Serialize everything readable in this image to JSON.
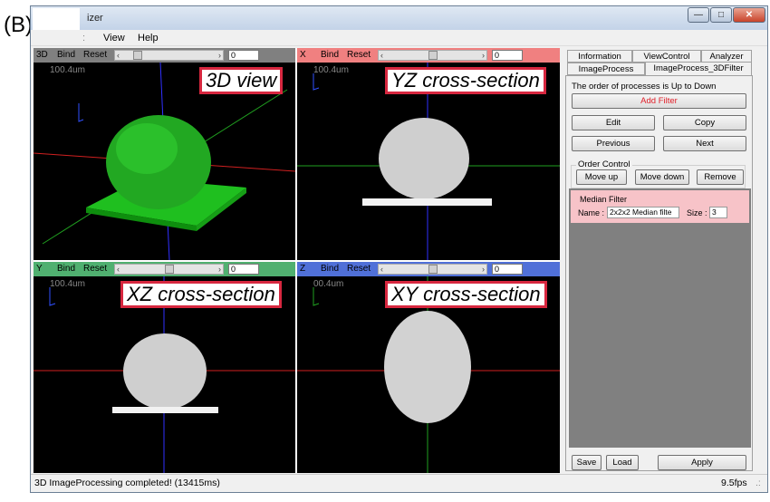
{
  "figure_label": "(B)",
  "window": {
    "title": "izer",
    "min_label": "—",
    "max_label": "□",
    "close_label": "✕"
  },
  "menu": {
    "view": "View",
    "help": "Help"
  },
  "viewports": {
    "v3d": {
      "label": "3D",
      "bind": "Bind",
      "reset": "Reset",
      "value": "0",
      "scale": "100.4um",
      "caption": "3D view",
      "bar_color": "#808080"
    },
    "vx": {
      "label": "X",
      "bind": "Bind",
      "reset": "Reset",
      "value": "0",
      "scale": "100.4um",
      "caption": "YZ cross-section",
      "bar_color": "#f08080"
    },
    "vy": {
      "label": "Y",
      "bind": "Bind",
      "reset": "Reset",
      "value": "0",
      "scale": "100.4um",
      "caption": "XZ cross-section",
      "bar_color": "#50b070"
    },
    "vz": {
      "label": "Z",
      "bind": "Bind",
      "reset": "Reset",
      "value": "0",
      "scale": "00.4um",
      "caption": "XY cross-section",
      "bar_color": "#5070d8"
    }
  },
  "tabs": {
    "information": "Information",
    "viewcontrol": "ViewControl",
    "analyzer": "Analyzer",
    "imageprocess": "ImageProcess",
    "imageprocess3d": "ImageProcess_3DFilter"
  },
  "panel": {
    "order_note": "The order of processes is Up to Down",
    "add_filter": "Add Filter",
    "edit": "Edit",
    "copy": "Copy",
    "previous": "Previous",
    "next": "Next",
    "order_control": "Order Control",
    "move_up": "Move up",
    "move_down": "Move down",
    "remove": "Remove",
    "save": "Save",
    "load": "Load",
    "apply": "Apply"
  },
  "filter": {
    "title": "Median Filter",
    "name_label": "Name :",
    "name_value": "2x2x2 Median filte",
    "size_label": "Size :",
    "size_value": "3"
  },
  "status": {
    "message": "3D ImageProcessing completed! (13415ms)",
    "fps": "9.5fps"
  },
  "colors": {
    "caption_border": "#d7273f",
    "add_filter_text": "#e0202a",
    "filter_item_bg": "#f7c3c8"
  }
}
